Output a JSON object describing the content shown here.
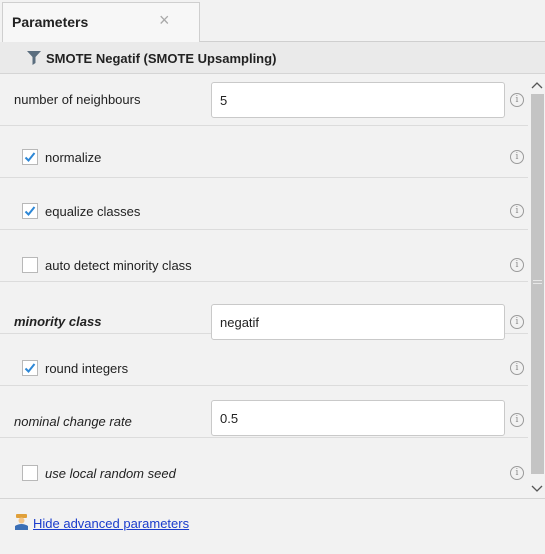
{
  "tab": {
    "label": "Parameters",
    "close_glyph": "×",
    "close_icon": "close-icon"
  },
  "operator": {
    "icon": "filter-icon",
    "icon_color": "#5b6e7f",
    "title": "SMOTE Negatif (SMOTE Upsampling)"
  },
  "params": [
    {
      "type": "text",
      "label": "number of neighbours",
      "value": "5"
    },
    {
      "type": "checkbox",
      "label": "normalize",
      "checked": true
    },
    {
      "type": "checkbox",
      "label": "equalize classes",
      "checked": true
    },
    {
      "type": "checkbox",
      "label": "auto detect minority class",
      "checked": false
    },
    {
      "type": "text",
      "label": "minority class",
      "value": "negatif",
      "style": "bold-italic"
    },
    {
      "type": "checkbox",
      "label": "round integers",
      "checked": true
    },
    {
      "type": "text",
      "label": "nominal change rate",
      "value": "0.5",
      "style": "italic"
    },
    {
      "type": "checkbox",
      "label": "use local random seed",
      "checked": false,
      "style": "italic"
    }
  ],
  "info_glyph": "i",
  "footer": {
    "icon": "person-icon",
    "link": "Hide advanced parameters"
  },
  "colors": {
    "checkmark": "#2d87d6",
    "link": "#1a3ccc",
    "background": "#f2f2f2"
  }
}
